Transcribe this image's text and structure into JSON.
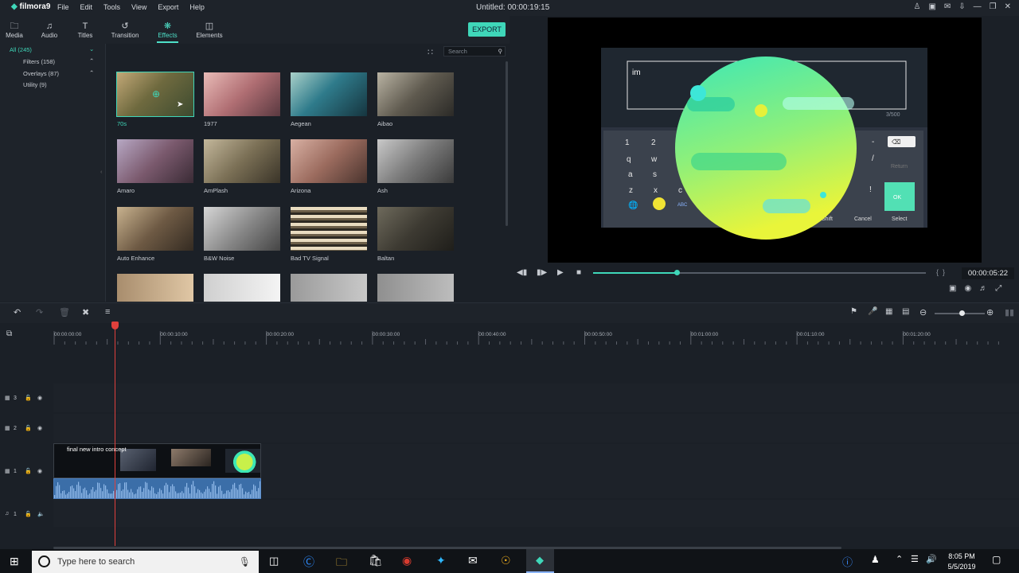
{
  "app": {
    "logo": "filmora9",
    "menu": [
      "File",
      "Edit",
      "Tools",
      "View",
      "Export",
      "Help"
    ],
    "title": "Untitled: 00:00:19:15"
  },
  "tabs": [
    {
      "label": "Media",
      "icon": "folder-icon"
    },
    {
      "label": "Audio",
      "icon": "music-icon"
    },
    {
      "label": "Titles",
      "icon": "text-icon"
    },
    {
      "label": "Transition",
      "icon": "transition-icon"
    },
    {
      "label": "Effects",
      "icon": "effects-icon",
      "active": true
    },
    {
      "label": "Elements",
      "icon": "image-icon"
    }
  ],
  "export_label": "EXPORT",
  "categories": [
    {
      "label": "All (245)",
      "selected": true
    },
    {
      "label": "Filters (158)"
    },
    {
      "label": "Overlays (87)"
    },
    {
      "label": "Utility (9)"
    }
  ],
  "search_placeholder": "Search",
  "effects": [
    {
      "label": "70s",
      "selected": true
    },
    {
      "label": "1977"
    },
    {
      "label": "Aegean"
    },
    {
      "label": "Aibao"
    },
    {
      "label": "Amaro"
    },
    {
      "label": "AmPlash"
    },
    {
      "label": "Arizona"
    },
    {
      "label": "Ash"
    },
    {
      "label": "Auto Enhance"
    },
    {
      "label": "B&W Noise"
    },
    {
      "label": "Bad TV Signal"
    },
    {
      "label": "Baltan"
    }
  ],
  "preview": {
    "input_text": "im",
    "char_count": "3/500",
    "keyboard": {
      "row1": [
        "1",
        "2"
      ],
      "row2": [
        "q",
        "w"
      ],
      "row3": [
        "a",
        "s"
      ],
      "row4": [
        "z",
        "x",
        "c"
      ],
      "abc": "ABC",
      "shift": "Shift",
      "cancel": "Cancel",
      "select": "Select",
      "ok": "OK",
      "return": "Return",
      "minus": "-",
      "slash": "/",
      "bang": "!"
    },
    "timecode": "00:00:05:22",
    "progress": 0.25
  },
  "ruler_labels": [
    "00:00:00:00",
    "00:00:10:00",
    "00:00:20:00",
    "00:00:30:00",
    "00:00:40:00",
    "00:00:50:00",
    "00:01:00:00",
    "00:01:10:00",
    "00:01:20:00"
  ],
  "tracks": [
    {
      "label": "3"
    },
    {
      "label": "2"
    },
    {
      "label": "1"
    },
    {
      "label": "1"
    }
  ],
  "clip_title": "final new intro concept",
  "taskbar": {
    "search_placeholder": "Type here to search",
    "time": "8:05 PM",
    "date": "5/5/2019"
  }
}
